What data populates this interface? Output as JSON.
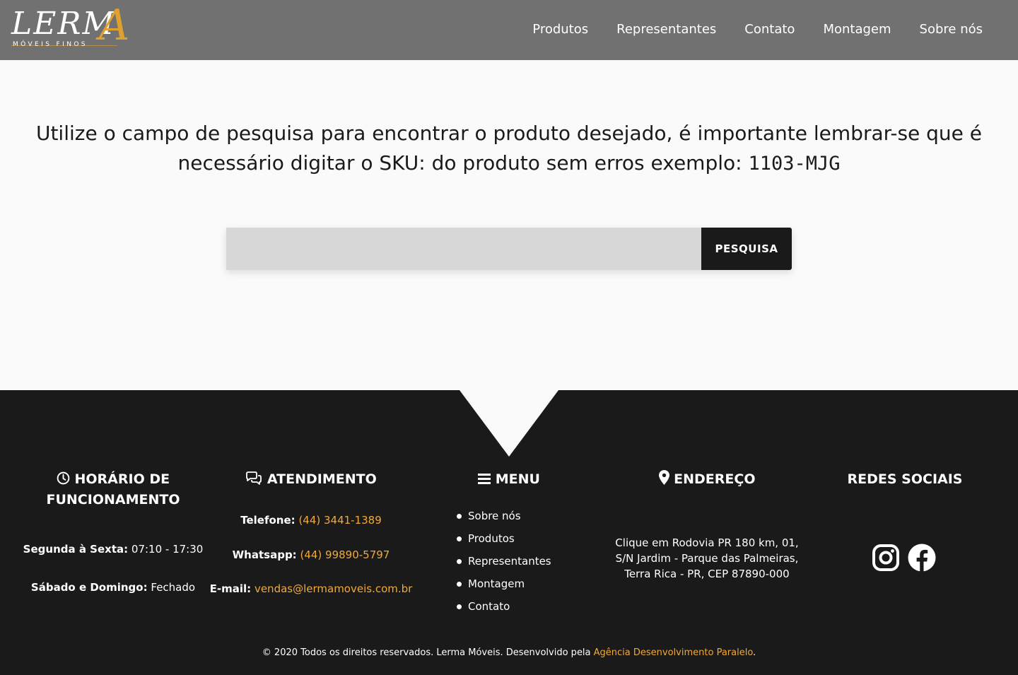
{
  "header": {
    "logo": {
      "main": "LERM",
      "accent": "A",
      "sub": "MÓVEIS FINOS"
    },
    "nav": [
      "Produtos",
      "Representantes",
      "Contato",
      "Montagem",
      "Sobre nós"
    ]
  },
  "main": {
    "intro_text": "Utilize o campo de pesquisa para encontrar o produto desejado, é importante lembrar-se que é necessário digitar o SKU: do produto sem erros exemplo:",
    "sku_example": "1103-MJG",
    "search": {
      "value": "",
      "placeholder": "",
      "button_label": "PESQUISA"
    }
  },
  "footer": {
    "hours": {
      "title": "HORÁRIO DE FUNCIONAMENTO",
      "weekday_label": "Segunda à Sexta:",
      "weekday_value": "07:10 - 17:30",
      "weekend_label": "Sábado e Domingo:",
      "weekend_value": "Fechado"
    },
    "atendimento": {
      "title": "ATENDIMENTO",
      "phone_label": "Telefone:",
      "phone": "(44) 3441-1389",
      "whatsapp_label": "Whatsapp:",
      "whatsapp": "(44) 99890-5797",
      "email_label": "E-mail:",
      "email": "vendas@lermamoveis.com.br"
    },
    "menu": {
      "title": "MENU",
      "items": [
        "Sobre nós",
        "Produtos",
        "Representantes",
        "Montagem",
        "Contato"
      ]
    },
    "endereco": {
      "title": "ENDEREÇO",
      "lines": [
        "Clique em Rodovia PR 180 km, 01,",
        "S/N Jardim - Parque das Palmeiras,",
        "Terra Rica - PR, CEP 87890-000"
      ]
    },
    "social": {
      "title": "REDES SOCIAIS",
      "icons": [
        "instagram-icon",
        "facebook-icon"
      ]
    },
    "copyright_text": "© 2020 Todos os direitos reservados. Lerma Móveis. Desenvolvido pela",
    "agency_link": "Agência Desenvolvimento Paralelo",
    "copyright_end": "."
  },
  "colors": {
    "header_bg": "#717171",
    "footer_bg": "#1a1a1a",
    "accent": "#f0a93a",
    "logo_accent": "#e0a030",
    "search_field": "#d7d7d7",
    "page_bg": "#fafafa"
  }
}
